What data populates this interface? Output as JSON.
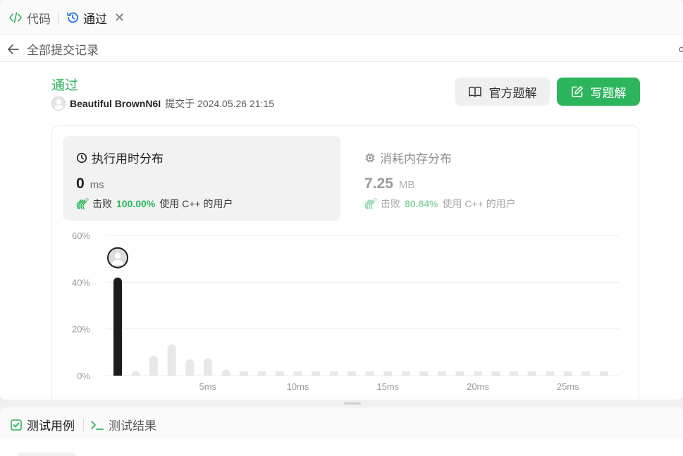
{
  "tabs": {
    "code_label": "代码",
    "passed_label": "通过",
    "close_glyph": "✕"
  },
  "subheader": {
    "back_label": "全部提交记录",
    "edge_glyph": "c"
  },
  "submission": {
    "status": "通过",
    "username": "Beautiful BrownN6I",
    "submitted_at": "提交于 2024.05.26 21:15"
  },
  "buttons": {
    "official_solution": "官方题解",
    "write_solution": "写题解"
  },
  "runtime": {
    "title": "执行用时分布",
    "value": "0",
    "unit": "ms",
    "beat_prefix": "击败",
    "beat_pct": "100.00%",
    "beat_suffix": "使用 C++ 的用户"
  },
  "memory": {
    "title": "消耗内存分布",
    "value": "7.25",
    "unit": "MB",
    "beat_prefix": "击败",
    "beat_pct": "80.84%",
    "beat_suffix": "使用 C++ 的用户"
  },
  "chart_data": {
    "type": "bar",
    "title": "",
    "xlabel": "",
    "ylabel": "",
    "ylim": [
      0,
      60
    ],
    "yticks": [
      "0%",
      "20%",
      "40%",
      "60%"
    ],
    "xticks": [
      "5ms",
      "10ms",
      "15ms",
      "20ms",
      "25ms"
    ],
    "xtick_positions": [
      5,
      10,
      15,
      20,
      25
    ],
    "grid": true,
    "highlight_index": 0,
    "x": [
      0,
      1,
      2,
      3,
      4,
      5,
      6,
      7,
      8,
      9,
      10,
      11,
      12,
      13,
      14,
      15,
      16,
      17,
      18,
      19,
      20,
      21,
      22,
      23,
      24,
      25,
      26,
      27
    ],
    "values": [
      42,
      2,
      8.5,
      13.5,
      7,
      7.5,
      2.6,
      1.8,
      1.8,
      1.8,
      1.8,
      1.8,
      1.8,
      1.8,
      1.8,
      1.8,
      1.8,
      1.8,
      1.8,
      1.8,
      1.8,
      1.8,
      1.8,
      1.8,
      1.8,
      1.8,
      1.8,
      1.8
    ],
    "colors": {
      "highlight": "#1c1c1c",
      "other": "#e8e8e8",
      "grid": "#ececec",
      "tick": "#9b9b9b"
    }
  },
  "bottom_tabs": {
    "cases_label": "测试用例",
    "result_label": "测试结果"
  },
  "colors": {
    "accent_green": "#2cb55d",
    "tab_blue": "#1a73e8"
  },
  "icons": [
    "code-icon",
    "history-icon",
    "close-icon",
    "back-arrow-icon",
    "book-icon",
    "edit-icon",
    "clock-icon",
    "chip-icon",
    "clap-icon",
    "checkbox-icon",
    "terminal-icon"
  ]
}
